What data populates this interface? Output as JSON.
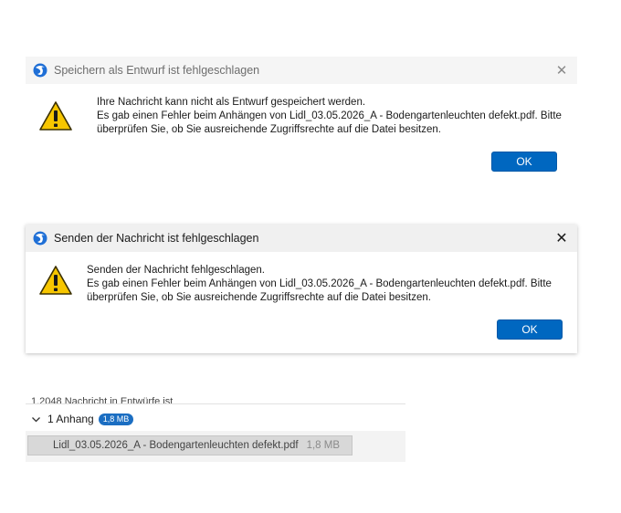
{
  "dialog_draft": {
    "title": "Speichern als Entwurf ist fehlgeschlagen",
    "lines": [
      "Ihre Nachricht kann nicht als Entwurf gespeichert werden.",
      "Es gab einen Fehler beim Anhängen von Lidl_03.05.2026_A - Bodengartenleuchten defekt.pdf. Bitte",
      "überprüfen Sie, ob Sie ausreichende Zugriffsrechte auf die Datei besitzen."
    ],
    "ok_label": "OK",
    "close_glyph": "✕"
  },
  "dialog_send": {
    "title": "Senden der Nachricht ist fehlgeschlagen",
    "lines": [
      "Senden der Nachricht fehlgeschlagen.",
      "Es gab einen Fehler beim Anhängen von Lidl_03.05.2026_A - Bodengartenleuchten defekt.pdf. Bitte",
      "überprüfen Sie, ob Sie ausreichende Zugriffsrechte auf die Datei besitzen."
    ],
    "ok_label": "OK",
    "close_glyph": "✕"
  },
  "attachments": {
    "cut_off_text": "1.2048 Nachricht in Entwürfe ist",
    "header_label": "1 Anhang",
    "total_size": "1,8 MB",
    "items": [
      {
        "name": "Lidl_03.05.2026_A - Bodengartenleuchten defekt.pdf",
        "size": "1,8 MB"
      }
    ]
  },
  "colors": {
    "accent": "#0067c0",
    "warning_yellow": "#f7c600",
    "badge": "#1b6ec2"
  },
  "icons": {
    "app": "thunderbird-icon",
    "warning": "warning-triangle-icon",
    "close": "close-icon",
    "chevron": "chevron-down-icon"
  }
}
